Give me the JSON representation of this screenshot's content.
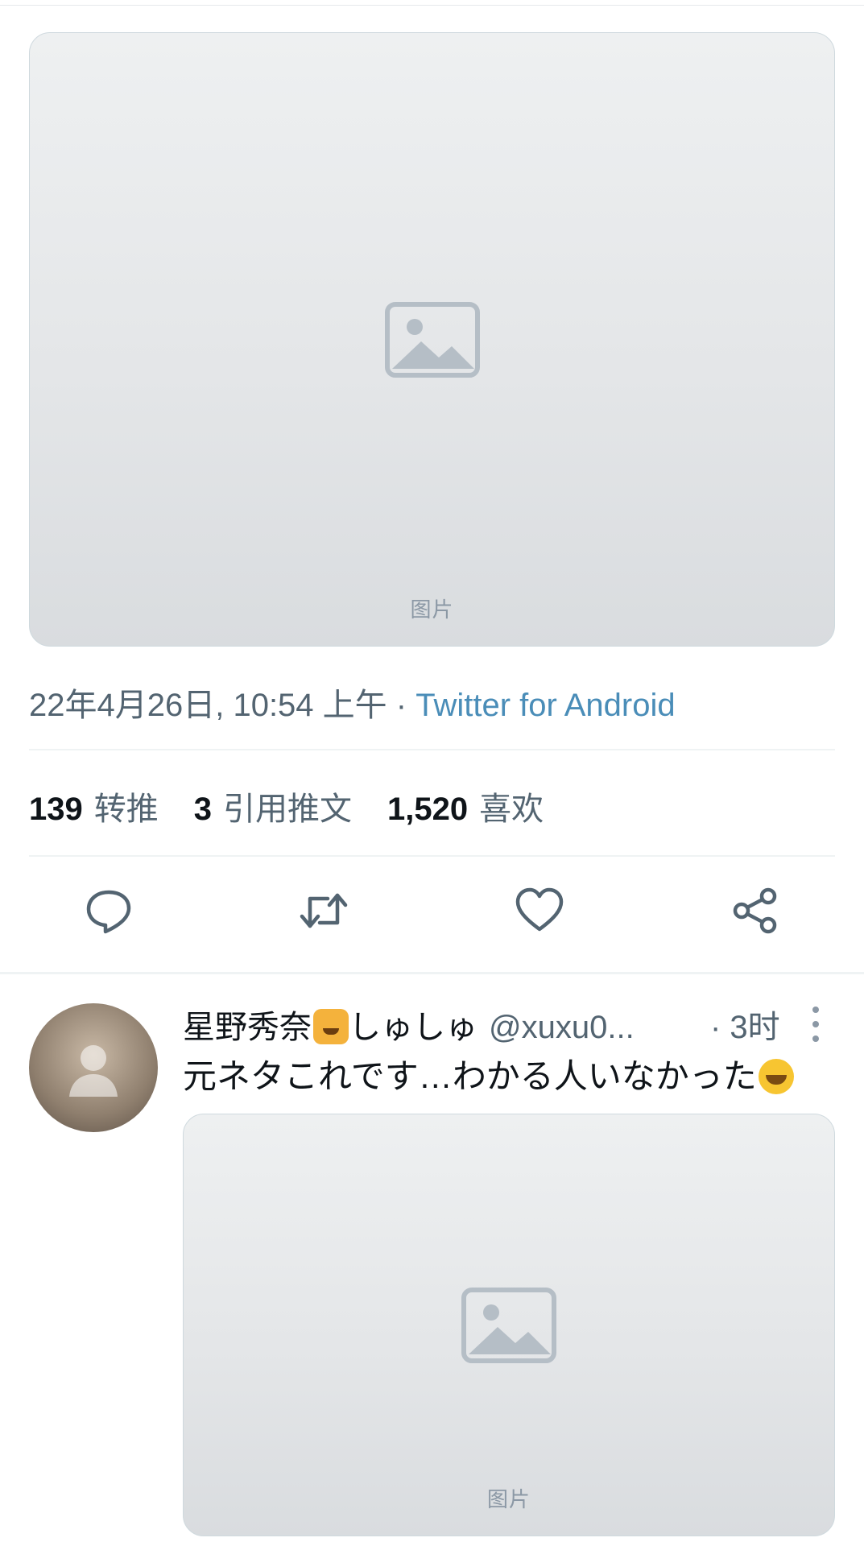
{
  "tweet": {
    "media_label": "图片",
    "timestamp": "22年4月26日, 10:54 上午",
    "separator": " · ",
    "source": "Twitter for Android",
    "stats": [
      {
        "count": "139",
        "label": "转推"
      },
      {
        "count": "3",
        "label": "引用推文"
      },
      {
        "count": "1,520",
        "label": "喜欢"
      }
    ],
    "actions": [
      "reply-icon",
      "retweet-icon",
      "like-icon",
      "share-icon"
    ]
  },
  "reply": {
    "display_name": "星野秀奈",
    "display_name_suffix": "しゅしゅ",
    "handle": "@xuxu0...",
    "time": "· 3时",
    "text": "元ネタこれです…わかる人いなかった",
    "media_label": "图片"
  },
  "colors": {
    "accent": "#1d9bf0",
    "muted": "#536471",
    "text": "#0f1419"
  }
}
